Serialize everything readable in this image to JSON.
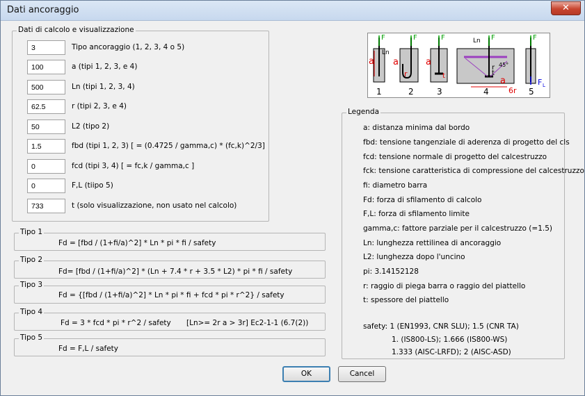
{
  "window": {
    "title": "Dati ancoraggio",
    "close": "✕"
  },
  "params": {
    "label": "Dati di calcolo e visualizzazione",
    "rows": [
      {
        "value": "3",
        "label": "Tipo ancoraggio (1, 2, 3, 4 o 5)"
      },
      {
        "value": "100",
        "label": "a (tipi 1, 2, 3, e 4)"
      },
      {
        "value": "500",
        "label": "Ln (tipi 1, 2, 3, 4)"
      },
      {
        "value": "62.5",
        "label": "r (tipi 2, 3, e 4)"
      },
      {
        "value": "50",
        "label": "L2 (tipo 2)"
      },
      {
        "value": "1.5",
        "label": "fbd (tipi 1, 2, 3)   [    = (0.4725 / gamma,c) * (fc,k)^2/3]"
      },
      {
        "value": "0",
        "label": "fcd (tipi 3, 4)   [ = fc,k / gamma,c ]"
      },
      {
        "value": "0",
        "label": "F,L (tiipo 5)"
      },
      {
        "value": "733",
        "label": "t (solo visualizzazione, non usato nel calcolo)"
      }
    ]
  },
  "types": [
    {
      "label": "Tipo 1",
      "formula": "Fd = [fbd / (1+fi/a)^2] *  Ln * pi * fi / safety"
    },
    {
      "label": "Tipo 2",
      "formula": "Fd= [fbd / (1+fi/a)^2] * (Ln + 7.4 * r + 3.5 * L2) * pi * fi / safety"
    },
    {
      "label": "Tipo 3",
      "formula": "Fd = {[fbd / (1+fi/a)^2] * Ln * pi * fi + fcd * pi * r^2} / safety"
    },
    {
      "label": "Tipo 4",
      "formula": "Fd = 3 * fcd * pi * r^2 / safety",
      "note": "[Ln>= 2r      a > 3r]  Ec2-1-1 (6.7(2))"
    },
    {
      "label": "Tipo 5",
      "formula": "Fd = F,L / safety"
    }
  ],
  "legend": {
    "label": "Legenda",
    "lines": [
      "a: distanza minima dal bordo",
      "fbd: tensione tangenziale di aderenza di progetto del cls",
      "fcd: tensione normale di progetto del calcestruzzo",
      "fck: tensione caratteristica di compressione del calcestruzzo",
      "fi: diametro barra",
      "Fd: forza di sfilamento di calcolo",
      "F,L: forza di sfilamento limite",
      "gamma,c: fattore parziale per il calcestruzzo (=1.5)",
      "Ln:   lunghezza rettilinea di ancoraggio",
      "L2: lunghezza dopo l'uncino",
      "pi: 3.14152128",
      "r: raggio di piega barra o raggio del piattello",
      "t: spessore del piattello"
    ],
    "safety": [
      "safety:  1 (EN1993, CNR SLU); 1.5 (CNR TA)",
      "1. (IS800-LS); 1.666  (IS800-WS)",
      "1.333 (AISC-LRFD); 2  (AISC-ASD)"
    ]
  },
  "figure": {
    "numbers": [
      "1",
      "2",
      "3",
      "4",
      "5"
    ],
    "labels": {
      "F": "F",
      "a": "a",
      "Ln": "Ln",
      "r": "r",
      "t": "t",
      "deg": "45°",
      "sixr": "6r",
      "FL": "F",
      "FLsub": "L"
    },
    "colors": {
      "red": "#e00000",
      "green": "#00a000",
      "blue": "#0000e0",
      "purple": "#9b3fbf",
      "gray": "#c8c8c8"
    }
  },
  "buttons": {
    "ok": "OK",
    "cancel": "Cancel"
  }
}
